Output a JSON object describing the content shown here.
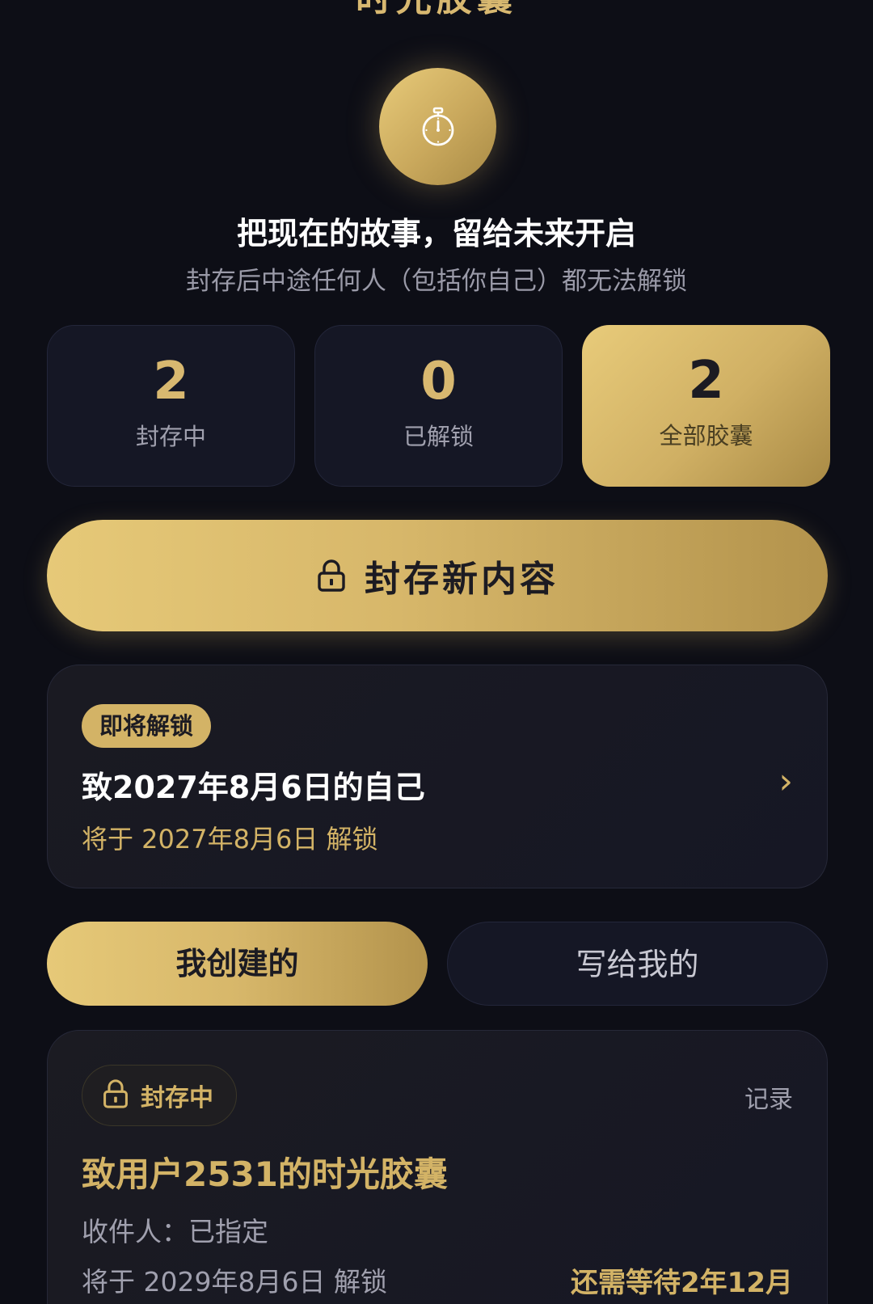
{
  "header": {
    "title_partial": "时光胶囊"
  },
  "hero": {
    "icon": "stopwatch-icon",
    "headline": "把现在的故事，留给未来开启",
    "subline": "封存后中途任何人（包括你自己）都无法解锁"
  },
  "stats": [
    {
      "value": "2",
      "label": "封存中"
    },
    {
      "value": "0",
      "label": "已解锁"
    },
    {
      "value": "2",
      "label": "全部胶囊"
    }
  ],
  "seal_button": {
    "icon": "lock-icon",
    "label": "封存新内容"
  },
  "upcoming": {
    "badge": "即将解锁",
    "title": "致2027年8月6日的自己",
    "unlock_text": "将于 2027年8月6日 解锁",
    "chevron": "›"
  },
  "tabs": [
    {
      "label": "我创建的",
      "active": true
    },
    {
      "label": "写给我的",
      "active": false
    }
  ],
  "capsule": {
    "status": "封存中",
    "status_icon": "lock-icon",
    "record_label": "记录",
    "title": "致用户2531的时光胶囊",
    "recipient": "收件人：已指定",
    "unlock_text": "将于 2029年8月6日 解锁",
    "wait_text": "还需等待2年12月"
  },
  "colors": {
    "background": "#0d0e16",
    "gold": "#d3b366",
    "card": "#151725"
  }
}
